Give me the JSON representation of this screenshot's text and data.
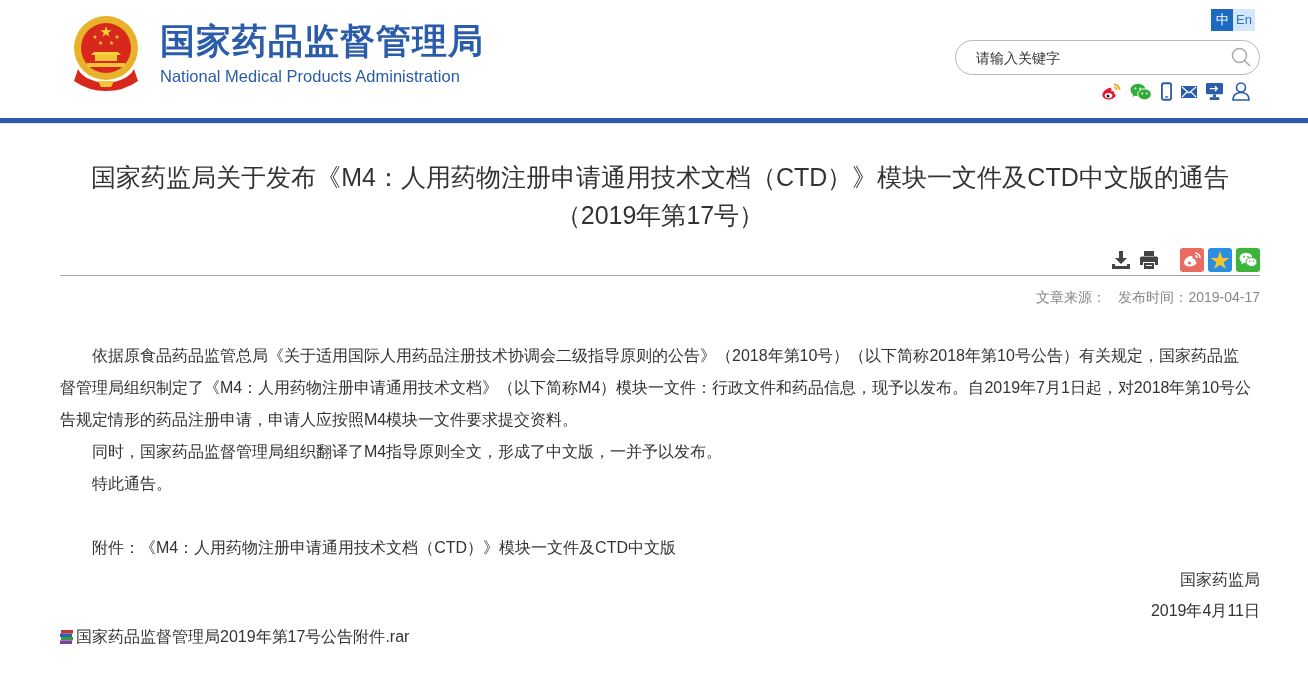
{
  "header": {
    "site_title": "国家药品监督管理局",
    "site_subtitle": "National Medical Products Administration",
    "languages": [
      {
        "label": "中",
        "selected": true
      },
      {
        "label": "En",
        "selected": false
      }
    ],
    "search": {
      "placeholder": "请输入关键字"
    }
  },
  "article": {
    "title": "国家药监局关于发布《M4：人用药物注册申请通用技术文档（CTD）》模块一文件及CTD中文版的通告（2019年第17号）",
    "meta": {
      "source_label": "文章来源：",
      "published": "发布时间：2019-04-17"
    },
    "paragraphs": [
      "依据原食品药品监管总局《关于适用国际人用药品注册技术协调会二级指导原则的公告》（2018年第10号）（以下简称2018年第10号公告）有关规定，国家药品监督管理局组织制定了《M4：人用药物注册申请通用技术文档》（以下简称M4）模块一文件：行政文件和药品信息，现予以发布。自2019年7月1日起，对2018年第10号公告规定情形的药品注册申请，申请人应按照M4模块一文件要求提交资料。",
      "同时，国家药品监督管理局组织翻译了M4指导原则全文，形成了中文版，一并予以发布。",
      "特此通告。"
    ],
    "attachment_note": "附件：《M4：人用药物注册申请通用技术文档（CTD）》模块一文件及CTD中文版",
    "signature": {
      "issuer": "国家药监局",
      "date": "2019年4月11日"
    },
    "attachment_file": "国家药品监督管理局2019年第17号公告附件.rar"
  }
}
